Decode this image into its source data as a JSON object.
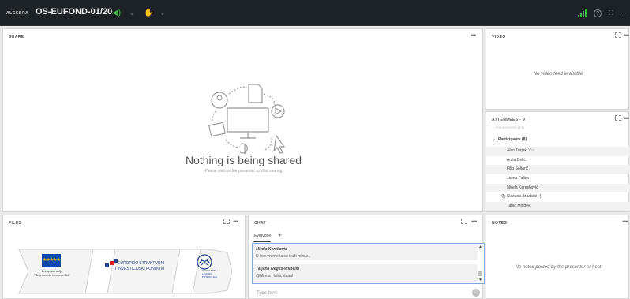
{
  "topbar": {
    "logo_text": "ALGEBRA",
    "room_title": "OS-EUFOND-01/20",
    "icons": [
      "speaker-icon",
      "chevron-down-icon",
      "raise-hand-icon",
      "chevron-down-icon",
      "signal-strength-icon",
      "help-icon",
      "fullscreen-icon",
      "more-icon"
    ],
    "colors": {
      "speaker": "#41b649",
      "signal": "#41b649",
      "bar": "#1d2226"
    }
  },
  "share": {
    "title": "SHARE",
    "menu": "•••",
    "heading": "Nothing is being shared",
    "subtext": "Please wait for the presenter to start sharing"
  },
  "video": {
    "title": "VIDEO",
    "menu": "•••",
    "empty": "No video feed available"
  },
  "attendees": {
    "title": "ATTENDEES - 9",
    "menu": "•••",
    "presenters": "✓ PRESENTERS (1/1)",
    "participants_label": "Participants (8)",
    "participants": [
      {
        "name": "Alen Turjak",
        "you": "You"
      },
      {
        "name": "Anita Delić",
        "you": ""
      },
      {
        "name": "Filip Šoltarić",
        "you": ""
      },
      {
        "name": "Jasna Falica",
        "you": ""
      },
      {
        "name": "Mirela Keresković",
        "you": ""
      },
      {
        "name": "Slaćana Bradarić",
        "you": ""
      },
      {
        "name": "Tanja Mindek",
        "you": ""
      }
    ],
    "speaking": "•))"
  },
  "files": {
    "title": "FILES",
    "menu": "•••",
    "banner": {
      "eu_stars": "★★★★★",
      "eu_text_1": "Europska unija",
      "eu_text_2": "\"Zajedno do fondova EU\"",
      "esif_line_1": "EUROPSKI STRUKTURNI",
      "esif_line_2": "I INVESTICIJSKI FONDOVI",
      "ship_text": "UČINKOVITI LJUDSKI POTENCIJALI"
    }
  },
  "chat": {
    "title": "CHAT",
    "menu": "•••",
    "tab": "Everyone",
    "add": "+",
    "messages": [
      {
        "author": "Mirela Kereković",
        "text": "U ovo vrernena se traži minus.."
      },
      {
        "author": "Tatjana Ivegeš-Wilhelm",
        "text": "@Mirela Haha, daaa!"
      }
    ],
    "input_placeholder": "Type here",
    "emoji": "☺"
  },
  "notes": {
    "title": "NOTES",
    "menu": "•••",
    "empty": "No notes posted by the presenter or host"
  }
}
